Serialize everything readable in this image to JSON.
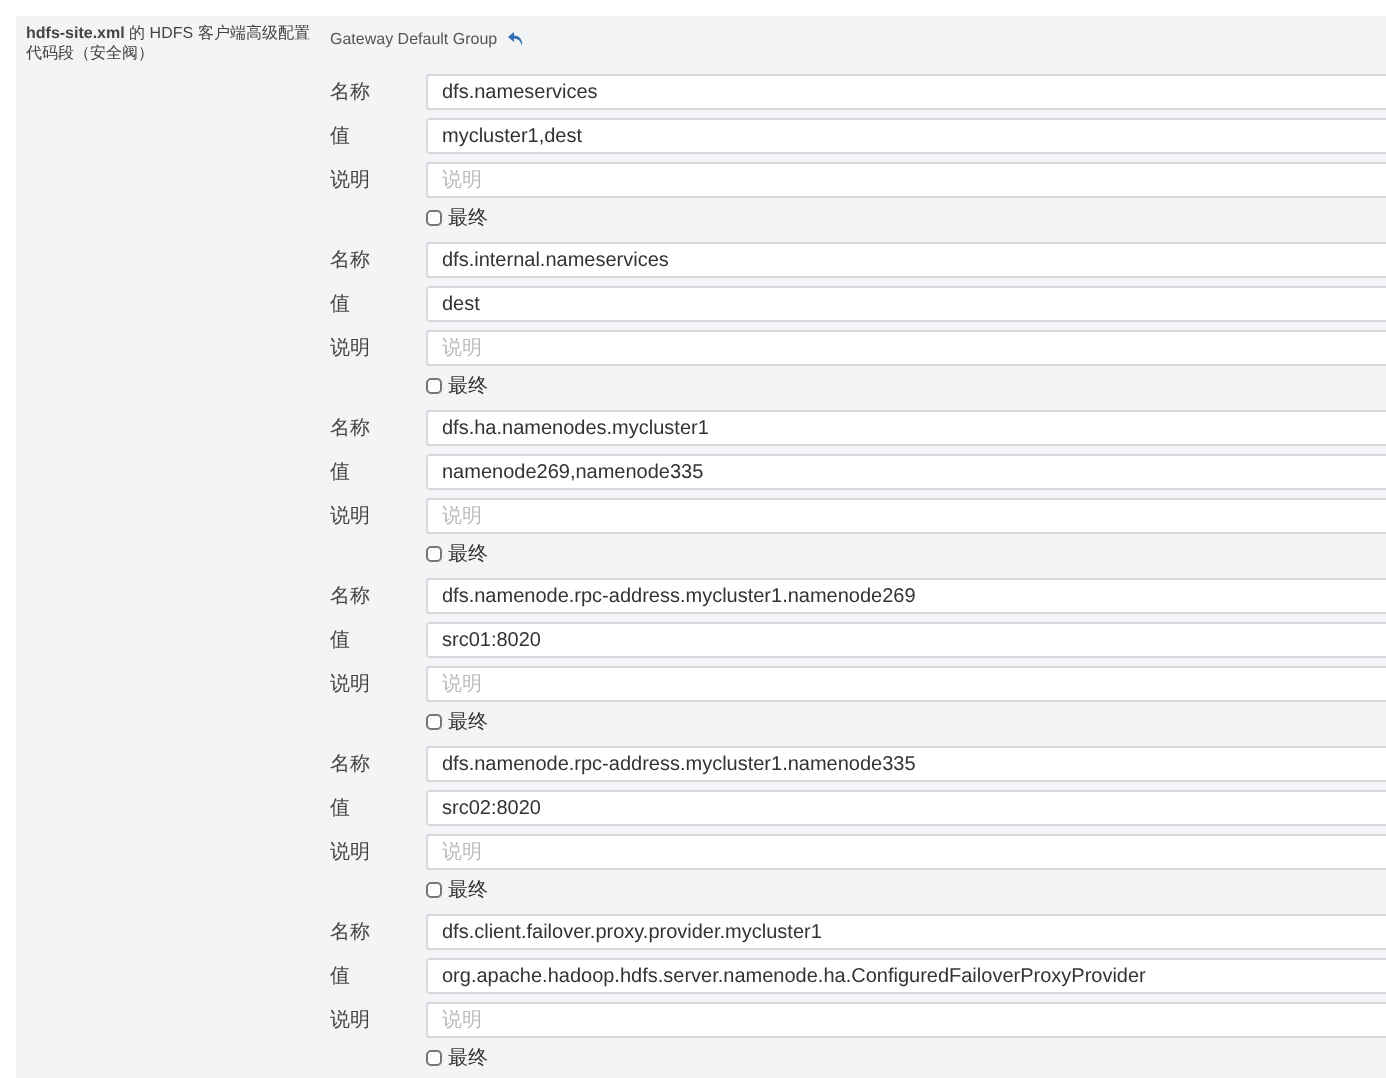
{
  "setting": {
    "title": "**hdfs-site.xml** 的 HDFS 客户端高级配置代码段（安全阀）",
    "group": "Gateway Default Group",
    "entries": [
      {
        "name_label": "名称",
        "name": "dfs.nameservices",
        "value_label": "值",
        "value": "mycluster1,dest",
        "description_label": "说明",
        "description_placeholder": "说明",
        "final_label": "最终",
        "final": false
      },
      {
        "name_label": "名称",
        "name": "dfs.internal.nameservices",
        "value_label": "值",
        "value": "dest",
        "description_label": "说明",
        "description_placeholder": "说明",
        "final_label": "最终",
        "final": false
      },
      {
        "name_label": "名称",
        "name": "dfs.ha.namenodes.mycluster1",
        "value_label": "值",
        "value": "namenode269,namenode335",
        "description_label": "说明",
        "description_placeholder": "说明",
        "final_label": "最终",
        "final": false
      },
      {
        "name_label": "名称",
        "name": "dfs.namenode.rpc-address.mycluster1.namenode269",
        "value_label": "值",
        "value": "src01:8020",
        "description_label": "说明",
        "description_placeholder": "说明",
        "final_label": "最终",
        "final": false
      },
      {
        "name_label": "名称",
        "name": "dfs.namenode.rpc-address.mycluster1.namenode335",
        "value_label": "值",
        "value": "src02:8020",
        "description_label": "说明",
        "description_placeholder": "说明",
        "final_label": "最终",
        "final": false
      },
      {
        "name_label": "名称",
        "name": "dfs.client.failover.proxy.provider.mycluster1",
        "value_label": "值",
        "value": "org.apache.hadoop.hdfs.server.namenode.ha.ConfiguredFailoverProxyProvider",
        "description_label": "说明",
        "description_placeholder": "说明",
        "final_label": "最终",
        "final": false
      }
    ]
  }
}
